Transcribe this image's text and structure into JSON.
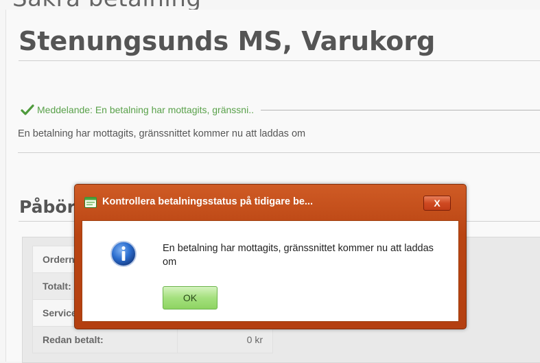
{
  "page": {
    "top_title_partial": "Säkra betalning",
    "shop_title": "Stenungsunds MS, Varukorg",
    "notice": {
      "label": "Meddelande: En betalning har mottagits, gränssni..",
      "body": "En betalning har mottagits, gränssnittet kommer nu att laddas om"
    },
    "section_title": "Påbörjade beställningar",
    "table": {
      "rows": [
        {
          "label": "Ordernummer:",
          "value": ""
        },
        {
          "label": "Totalt:",
          "value": ""
        },
        {
          "label": "Serviceavgift:",
          "value": ""
        },
        {
          "label": "Redan betalt:",
          "value": "0 kr"
        }
      ]
    }
  },
  "dialog": {
    "title": "Kontrollera betalningsstatus på tidigare be...",
    "close_label": "X",
    "message": "En betalning har mottagits, gränssnittet kommer nu att laddas om",
    "ok_label": "OK"
  },
  "colors": {
    "dialog_frame": "#b94412",
    "notice_green": "#59a14a",
    "ok_button": "#a4e07e",
    "info_blue": "#1e5bb8"
  },
  "icons": {
    "notice": "checkmark-icon",
    "dialog_app": "window-app-icon",
    "dialog_info": "info-icon",
    "close": "close-icon"
  }
}
